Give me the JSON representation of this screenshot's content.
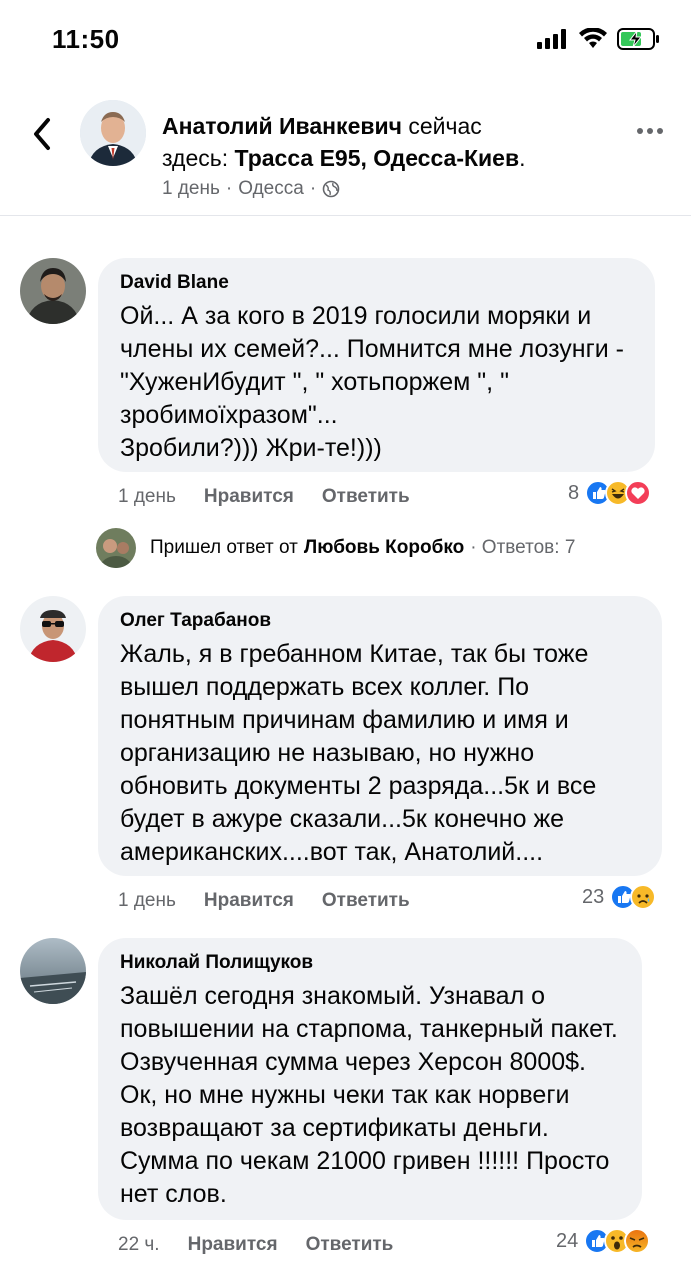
{
  "status_bar": {
    "time": "11:50"
  },
  "post": {
    "author": "Анатолий Иванкевич",
    "status_word": "сейчас",
    "location_prefix": "здесь:",
    "location": "Трасса Е95, Одесса-Киев",
    "location_suffix": ".",
    "meta_time": "1 день",
    "meta_place": "Одесса",
    "meta_sep": "·"
  },
  "comments": [
    {
      "author": "David Blane",
      "text": "Ой... А за кого в 2019 голосили моряки и члены их семей?...  Помнится мне лозунги - \"ХуженИбудит \", \" хотьпоржем \", \" зробимоїхразом\"...\nЗробили?))) Жри-те!)))",
      "time": "1 день",
      "like": "Нравится",
      "reply": "Ответить",
      "reaction_count": "8",
      "reactions": [
        "like",
        "haha",
        "love"
      ]
    },
    {
      "author": "Олег Тарабанов",
      "text": "Жаль, я в гребанном Китае, так бы тоже вышел поддержать всех коллег. По понятным причинам фамилию и имя и организацию не называю, но нужно обновить документы 2 разряда...5к и все будет в ажуре сказали...5к конечно же американских....вот так, Анатолий....",
      "time": "1 день",
      "like": "Нравится",
      "reply": "Ответить",
      "reaction_count": "23",
      "reactions": [
        "like",
        "sad"
      ]
    },
    {
      "author": "Николай Полищуков",
      "text": "Зашёл сегодня знакомый. Узнавал о повышении на старпома, танкерный пакет. Озвученная сумма через Херсон 8000$. Ок, но мне нужны чеки так как норвеги возвращают за сертификаты деньги. Сумма по чекам 21000 гривен !!!!!! Просто нет слов.",
      "time": "22 ч.",
      "like": "Нравится",
      "reply": "Ответить",
      "reaction_count": "24",
      "reactions": [
        "like",
        "wow",
        "angry"
      ]
    }
  ],
  "reply_summary": {
    "label": "Пришел ответ от",
    "author": "Любовь Коробко",
    "count": "· Ответов: 7"
  },
  "colors": {
    "like_blue": "#1877f2",
    "haha_yellow": "#f7b928",
    "love_red": "#f33e58",
    "angry_orange": "#e9710f",
    "bubble_bg": "#f0f2f5",
    "meta_gray": "#65676b"
  }
}
